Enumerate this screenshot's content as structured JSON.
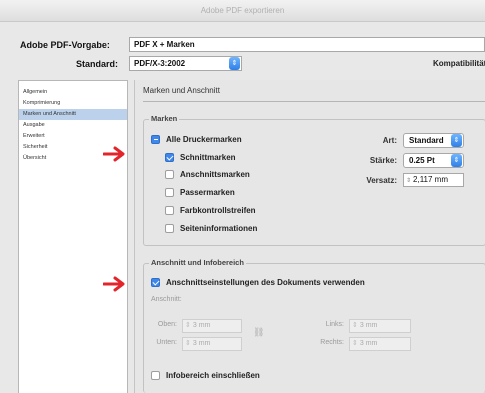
{
  "window": {
    "title": "Adobe PDF exportieren"
  },
  "header": {
    "preset_label": "Adobe PDF-Vorgabe:",
    "preset_value": "PDF X + Marken",
    "standard_label": "Standard:",
    "standard_value": "PDF/X-3:2002",
    "compat_label": "Kompatibilität"
  },
  "sidebar": {
    "items": [
      {
        "label": "Allgemein"
      },
      {
        "label": "Komprimierung"
      },
      {
        "label": "Marken und Anschnitt"
      },
      {
        "label": "Ausgabe"
      },
      {
        "label": "Erweitert"
      },
      {
        "label": "Sicherheit"
      },
      {
        "label": "Übersicht"
      }
    ],
    "selected_index": 2
  },
  "panel": {
    "title": "Marken und Anschnitt",
    "marks_group": {
      "label": "Marken",
      "all_marks": "Alle Druckermarken",
      "items": [
        {
          "label": "Schnittmarken",
          "checked": true
        },
        {
          "label": "Anschnittsmarken",
          "checked": false
        },
        {
          "label": "Passermarken",
          "checked": false
        },
        {
          "label": "Farbkontrollstreifen",
          "checked": false
        },
        {
          "label": "Seiteninformationen",
          "checked": false
        }
      ],
      "type_label": "Art:",
      "type_value": "Standard",
      "weight_label": "Stärke:",
      "weight_value": "0.25 Pt",
      "offset_label": "Versatz:",
      "offset_value": "2,117 mm"
    },
    "bleed_group": {
      "label": "Anschnitt und Infobereich",
      "use_document": "Anschnittseinstellungen des Dokuments verwenden",
      "bleed_label": "Anschnitt:",
      "top_label": "Oben:",
      "top_value": "3 mm",
      "bottom_label": "Unten:",
      "bottom_value": "3 mm",
      "left_label": "Links:",
      "left_value": "3 mm",
      "right_label": "Rechts:",
      "right_value": "3 mm",
      "slug": "Infobereich einschließen"
    }
  },
  "colors": {
    "accent": "#3f88ea",
    "arrow": "#e2252b",
    "selection": "#bcd2ec"
  }
}
